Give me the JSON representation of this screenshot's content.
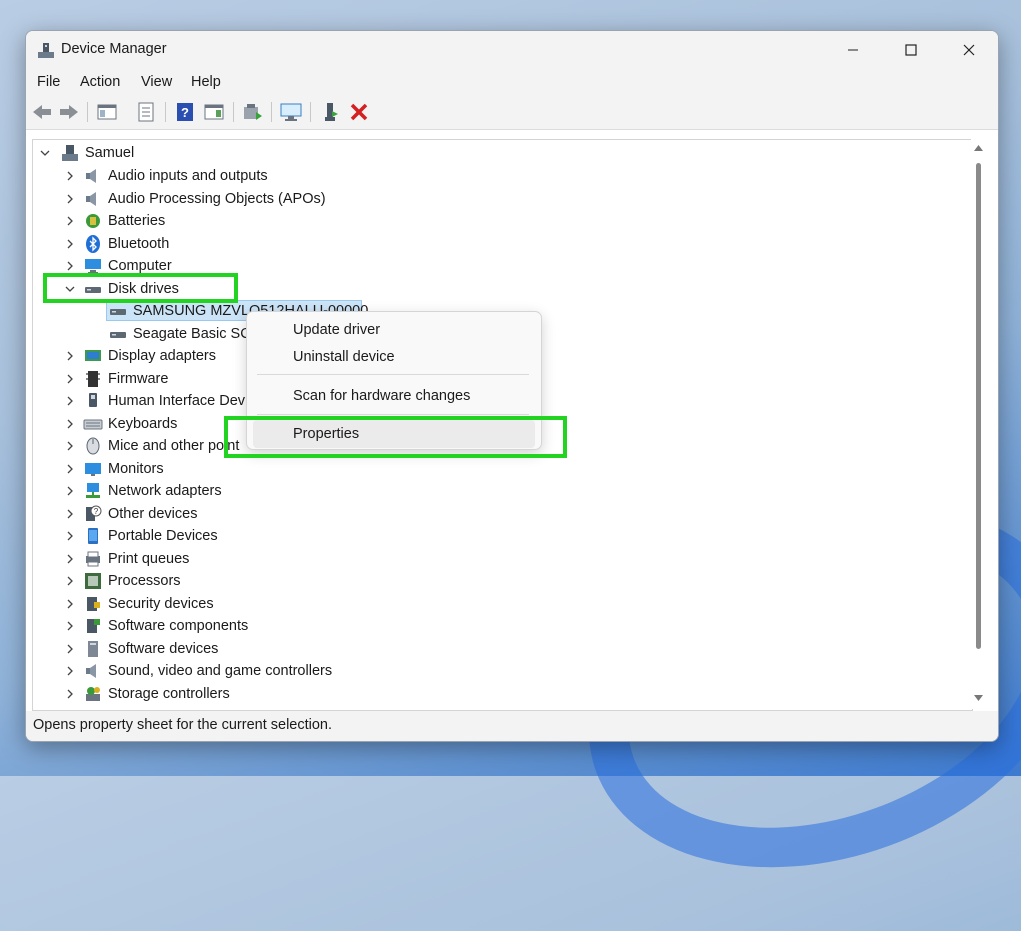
{
  "window": {
    "title": "Device Manager"
  },
  "menubar": [
    "File",
    "Action",
    "View",
    "Help"
  ],
  "toolbar_icons": [
    "back-icon",
    "forward-icon",
    "show-hide-console-tree-icon",
    "properties-icon",
    "help-icon",
    "action-pane-icon",
    "update-driver-icon",
    "scan-hardware-icon",
    "enable-device-icon",
    "uninstall-icon"
  ],
  "tree": {
    "root": "Samuel",
    "categories": [
      "Audio inputs and outputs",
      "Audio Processing Objects (APOs)",
      "Batteries",
      "Bluetooth",
      "Computer",
      "Disk drives",
      "SAMSUNG MZVLQ512HALU-00000",
      "Seagate Basic SCS",
      "Display adapters",
      "Firmware",
      "Human Interface Dev",
      "Keyboards",
      "Mice and other point",
      "Monitors",
      "Network adapters",
      "Other devices",
      "Portable Devices",
      "Print queues",
      "Processors",
      "Security devices",
      "Software components",
      "Software devices",
      "Sound, video and game controllers",
      "Storage controllers"
    ]
  },
  "context_menu": {
    "update_driver": "Update driver",
    "uninstall_device": "Uninstall device",
    "scan": "Scan for hardware changes",
    "properties": "Properties"
  },
  "status": "Opens property sheet for the current selection.",
  "colors": {
    "highlight": "#22d322",
    "selection": "#cce4f7"
  }
}
